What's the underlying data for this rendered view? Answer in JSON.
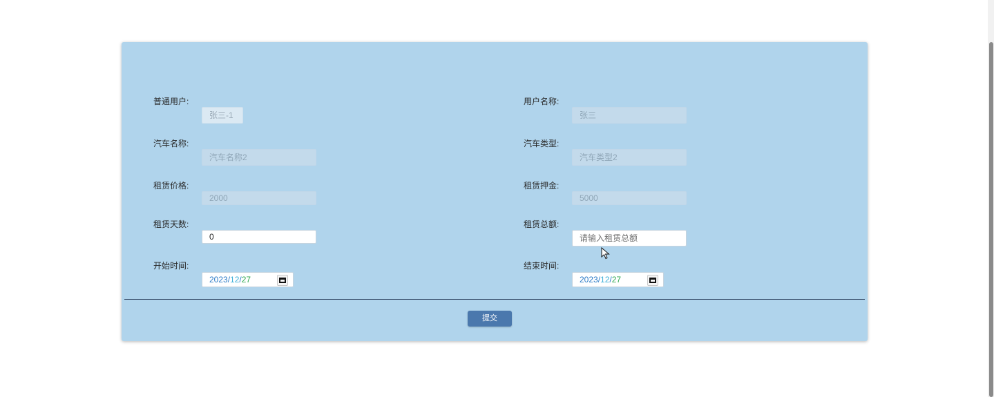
{
  "form": {
    "left_column": [
      {
        "label": "普通用户:",
        "value": "张三-1",
        "placeholder": "",
        "state": "disabled"
      },
      {
        "label": "汽车名称:",
        "value": "汽车名称2",
        "placeholder": "",
        "state": "disabled"
      },
      {
        "label": "租赁价格:",
        "value": "2000",
        "placeholder": "",
        "state": "disabled"
      },
      {
        "label": "租赁天数:",
        "value": "0",
        "placeholder": "",
        "state": "enabled"
      },
      {
        "label": "开始时间:",
        "year": "2023",
        "month": "12",
        "day": "27",
        "sep": "/",
        "state": "date"
      }
    ],
    "right_column": [
      {
        "label": "用户名称:",
        "value": "张三",
        "placeholder": "",
        "state": "disabled"
      },
      {
        "label": "汽车类型:",
        "value": "汽车类型2",
        "placeholder": "",
        "state": "disabled"
      },
      {
        "label": "租赁押金:",
        "value": "5000",
        "placeholder": "",
        "state": "disabled"
      },
      {
        "label": "租赁总额:",
        "value": "",
        "placeholder": "请输入租赁总额",
        "state": "enabled"
      },
      {
        "label": "结束时间:",
        "year": "2023",
        "month": "12",
        "day": "27",
        "sep": "/",
        "state": "date"
      }
    ],
    "submit_label": "提交"
  },
  "colors": {
    "panel_background": "#b0d4ec",
    "submit_button": "#4a78ad",
    "divider": "#2a3f5c",
    "date_year": "#2b7bc7",
    "date_month": "#3eb0d9",
    "date_day": "#2fa84f"
  },
  "icons": {
    "calendar": "calendar-icon",
    "cursor": "mouse-pointer-icon"
  }
}
